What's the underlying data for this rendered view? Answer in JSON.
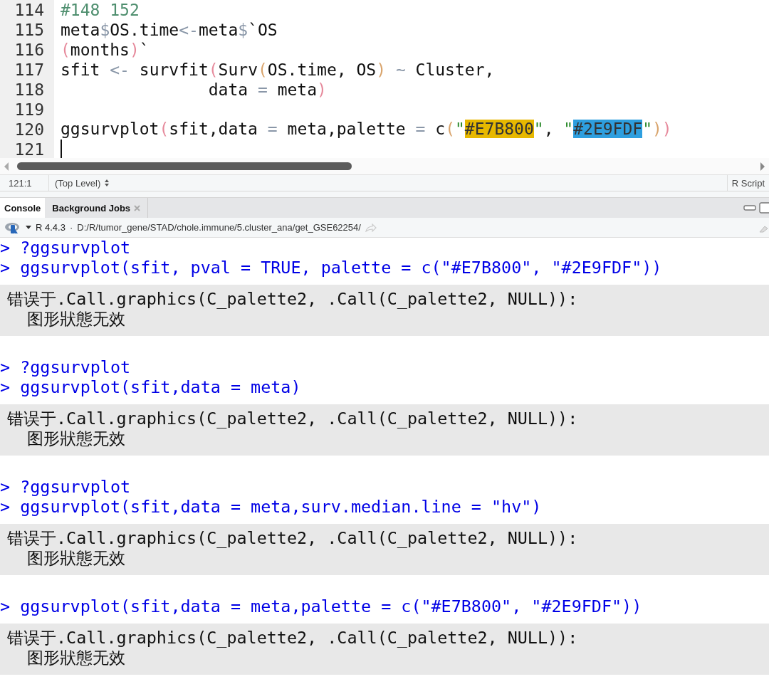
{
  "editor": {
    "lines": [
      {
        "number": "114",
        "tokens": [
          {
            "kind": "comment",
            "text": "#148 152"
          }
        ]
      },
      {
        "number": "115",
        "tokens": [
          {
            "kind": "plain",
            "text": "meta"
          },
          {
            "kind": "op",
            "text": "$"
          },
          {
            "kind": "plain",
            "text": "OS.time"
          },
          {
            "kind": "op",
            "text": "<-"
          },
          {
            "kind": "plain",
            "text": "meta"
          },
          {
            "kind": "op",
            "text": "$"
          },
          {
            "kind": "plain",
            "text": "`OS"
          }
        ]
      },
      {
        "number": "116",
        "tokens": [
          {
            "kind": "paren1",
            "text": "("
          },
          {
            "kind": "plain",
            "text": "months"
          },
          {
            "kind": "paren1",
            "text": ")"
          },
          {
            "kind": "plain",
            "text": "`"
          }
        ]
      },
      {
        "number": "117",
        "tokens": [
          {
            "kind": "plain",
            "text": "sfit "
          },
          {
            "kind": "op",
            "text": "<-"
          },
          {
            "kind": "plain",
            "text": " survfit"
          },
          {
            "kind": "paren1",
            "text": "("
          },
          {
            "kind": "plain",
            "text": "Surv"
          },
          {
            "kind": "paren2",
            "text": "("
          },
          {
            "kind": "plain",
            "text": "OS.time, OS"
          },
          {
            "kind": "paren2",
            "text": ")"
          },
          {
            "kind": "op",
            "text": " ~"
          },
          {
            "kind": "plain",
            "text": " Cluster,"
          }
        ]
      },
      {
        "number": "118",
        "tokens": [
          {
            "kind": "plain",
            "text": "               data "
          },
          {
            "kind": "op",
            "text": "="
          },
          {
            "kind": "plain",
            "text": " meta"
          },
          {
            "kind": "paren1",
            "text": ")"
          }
        ]
      },
      {
        "number": "119"
      },
      {
        "number": "120",
        "tokens": [
          {
            "kind": "plain",
            "text": "ggsurvplot"
          },
          {
            "kind": "paren1",
            "text": "("
          },
          {
            "kind": "plain",
            "text": "sfit,data "
          },
          {
            "kind": "op",
            "text": "="
          },
          {
            "kind": "plain",
            "text": " meta,palette "
          },
          {
            "kind": "op",
            "text": "="
          },
          {
            "kind": "plain",
            "text": " c"
          },
          {
            "kind": "paren2",
            "text": "("
          },
          {
            "kind": "string",
            "text": "\""
          },
          {
            "kind": "swatch",
            "text": "#E7B800",
            "color": "#e7b800"
          },
          {
            "kind": "string",
            "text": "\""
          },
          {
            "kind": "plain",
            "text": ", "
          },
          {
            "kind": "string",
            "text": "\""
          },
          {
            "kind": "swatch",
            "text": "#2E9FDF",
            "color": "#2e9fdf"
          },
          {
            "kind": "string",
            "text": "\""
          },
          {
            "kind": "paren2",
            "text": ")"
          },
          {
            "kind": "paren1",
            "text": ")"
          }
        ]
      },
      {
        "number": "121",
        "cursor": true
      }
    ]
  },
  "status_bar": {
    "position": "121:1",
    "scope": "(Top Level)",
    "file_type": "R Script"
  },
  "tabs": [
    {
      "label": "Console",
      "selected": true,
      "closable": false
    },
    {
      "label": "Background Jobs",
      "selected": false,
      "closable": true
    }
  ],
  "console_header": {
    "version": "R 4.4.3",
    "separator": "·",
    "path": "D:/R/tumor_gene/STAD/chole.immune/5.cluster_ana/get_GSE62254/"
  },
  "console": [
    {
      "kind": "input",
      "text": "> ?ggsurvplot"
    },
    {
      "kind": "input",
      "text": "> ggsurvplot(sfit, pval = TRUE, palette = c(\"#E7B800\", \"#2E9FDF\"))"
    },
    {
      "kind": "error",
      "lines": [
        "错误于.Call.graphics(C_palette2, .Call(C_palette2, NULL)):",
        "  图形狀態无效"
      ]
    },
    {
      "kind": "input",
      "text": "> ?ggsurvplot"
    },
    {
      "kind": "input",
      "text": "> ggsurvplot(sfit,data = meta)"
    },
    {
      "kind": "error",
      "lines": [
        "错误于.Call.graphics(C_palette2, .Call(C_palette2, NULL)):",
        "  图形狀態无效"
      ]
    },
    {
      "kind": "input",
      "text": "> ?ggsurvplot"
    },
    {
      "kind": "input",
      "text": "> ggsurvplot(sfit,data = meta,surv.median.line = \"hv\")"
    },
    {
      "kind": "error",
      "lines": [
        "错误于.Call.graphics(C_palette2, .Call(C_palette2, NULL)):",
        "  图形狀態无效"
      ]
    },
    {
      "kind": "input",
      "text": "> ggsurvplot(sfit,data = meta,palette = c(\"#E7B800\", \"#2E9FDF\"))"
    },
    {
      "kind": "error",
      "lines": [
        "错误于.Call.graphics(C_palette2, .Call(C_palette2, NULL)):",
        "  图形狀態无效"
      ]
    }
  ]
}
